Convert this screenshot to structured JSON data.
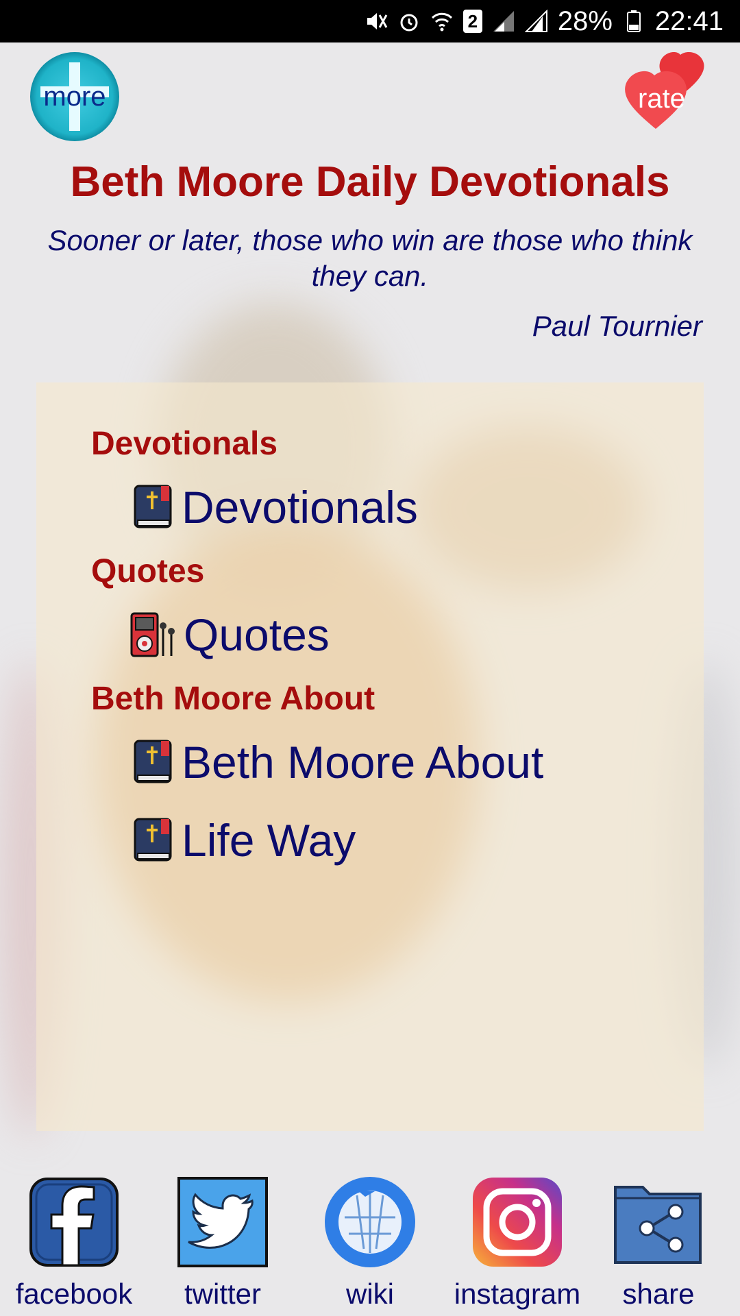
{
  "status_bar": {
    "sim_badge": "2",
    "battery": "28%",
    "time": "22:41"
  },
  "header": {
    "more_label": "more",
    "rate_label": "rate",
    "title": "Beth Moore Daily Devotionals",
    "quote": "Sooner or later, those who win are those who think they can.",
    "author": "Paul Tournier"
  },
  "menu": {
    "sections": [
      {
        "heading": "Devotionals",
        "items": [
          {
            "label": "Devotionals",
            "icon": "bible-icon"
          }
        ]
      },
      {
        "heading": "Quotes",
        "items": [
          {
            "label": "Quotes",
            "icon": "music-player-icon"
          }
        ]
      },
      {
        "heading": "Beth Moore About",
        "items": [
          {
            "label": "Beth Moore About",
            "icon": "bible-icon"
          },
          {
            "label": "Life Way",
            "icon": "bible-icon"
          }
        ]
      }
    ]
  },
  "footer": {
    "links": [
      {
        "label": "facebook",
        "icon": "facebook-icon"
      },
      {
        "label": "twitter",
        "icon": "twitter-icon"
      },
      {
        "label": "wiki",
        "icon": "wikipedia-icon"
      },
      {
        "label": "instagram",
        "icon": "instagram-icon"
      },
      {
        "label": "share",
        "icon": "share-icon"
      }
    ]
  },
  "colors": {
    "heading_red": "#a50d0d",
    "text_navy": "#0b0b6b",
    "panel_cream": "#f6e8cd"
  }
}
